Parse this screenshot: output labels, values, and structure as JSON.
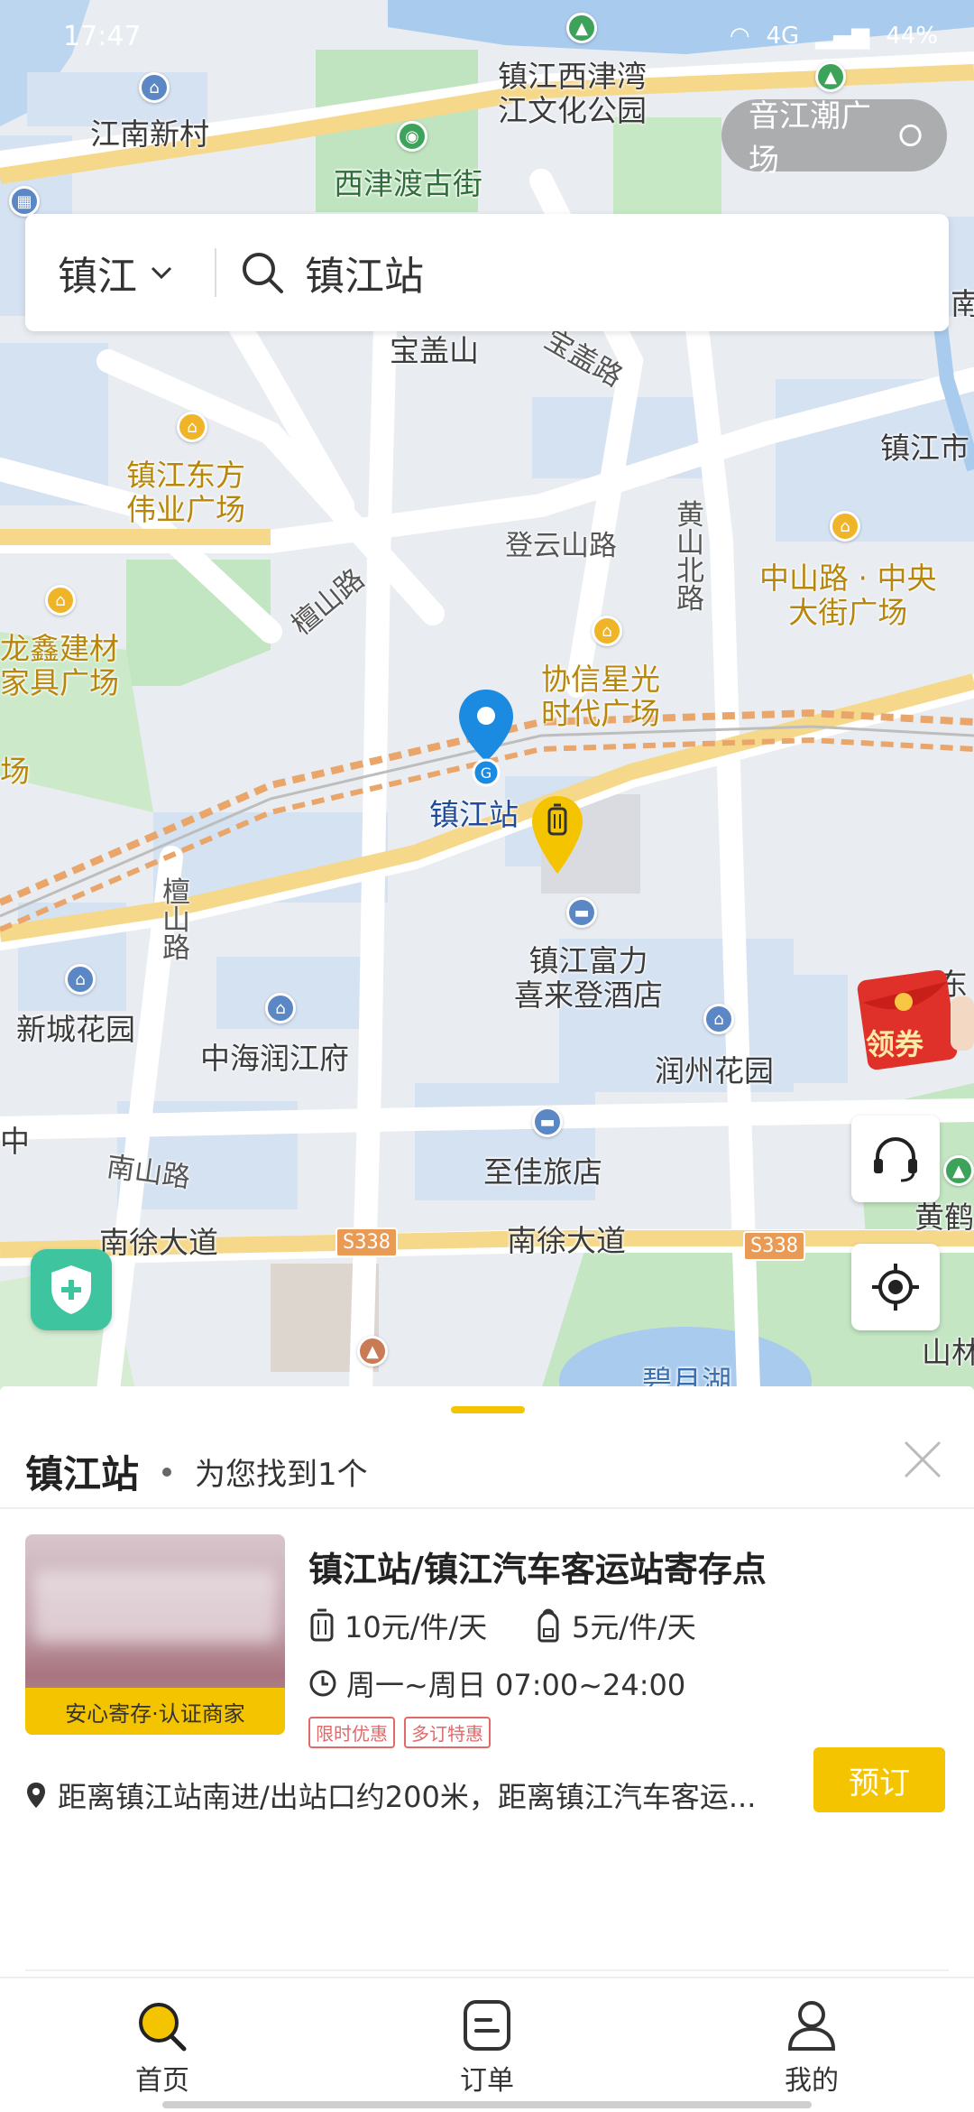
{
  "status_bar": {
    "time": "17:47",
    "battery": "44%",
    "network": "4G"
  },
  "search": {
    "city": "镇江",
    "query": "镇江站"
  },
  "map": {
    "top_chip": "音江潮广场",
    "labels": {
      "jiangnan_xincun": "江南新村",
      "xijin_park": "镇江西津湾\n江文化公园",
      "xijindu": "西津渡古街",
      "baogaishan": "宝盖山",
      "baogai_road": "宝盖路",
      "zhenjiang_city": "镇江市",
      "dongfang": "镇江东方\n伟业广场",
      "dengyunshan_road": "登云山路",
      "huangshan_north": "黄\n山\n北\n路",
      "zhongshan": "中山路 · 中央\n大街广场",
      "tanshan_road": "檀山路",
      "longxin": "龙鑫建材\n家具广场",
      "xiexin": "协信星光\n时代广场",
      "station": "镇江站",
      "tanshan_road2": "檀\n山\n路",
      "fuli": "镇江富力\n喜来登酒店",
      "xincheng": "新城花园",
      "zhonghai": "中海润江府",
      "runzhou": "润州花园",
      "zhijia": "至佳旅店",
      "nanshan_road": "南山路",
      "nanxu_w": "南徐大道",
      "nanxu_e": "南徐大道",
      "huanghe": "黄鹤",
      "shanlin": "山林",
      "lake": "碧月湖",
      "hwy1": "S338",
      "hwy2": "S338",
      "edge_nan": "南",
      "edge_chang": "场",
      "edge_zhong": "中",
      "edge_fang": "东"
    },
    "coupon_label": "领券"
  },
  "sheet": {
    "title": "镇江站",
    "result_text": "为您找到1个",
    "card": {
      "name": "镇江站/镇江汽车客运站寄存点",
      "price_luggage": "10元/件/天",
      "price_bag": "5元/件/天",
      "hours": "周一~周日 07:00~24:00",
      "tags": [
        "限时优惠",
        "多订特惠"
      ],
      "badge": "安心寄存·认证商家",
      "address": "距离镇江站南进/出站口约200米，距离镇江汽车客运...",
      "book_label": "预订"
    }
  },
  "tabs": [
    {
      "label": "首页",
      "active": true
    },
    {
      "label": "订单",
      "active": false
    },
    {
      "label": "我的",
      "active": false
    }
  ],
  "colors": {
    "accent": "#f5c400",
    "pin_blue": "#1a8be0",
    "shield": "#3fc4a0",
    "tag_red": "#e06a6a"
  }
}
